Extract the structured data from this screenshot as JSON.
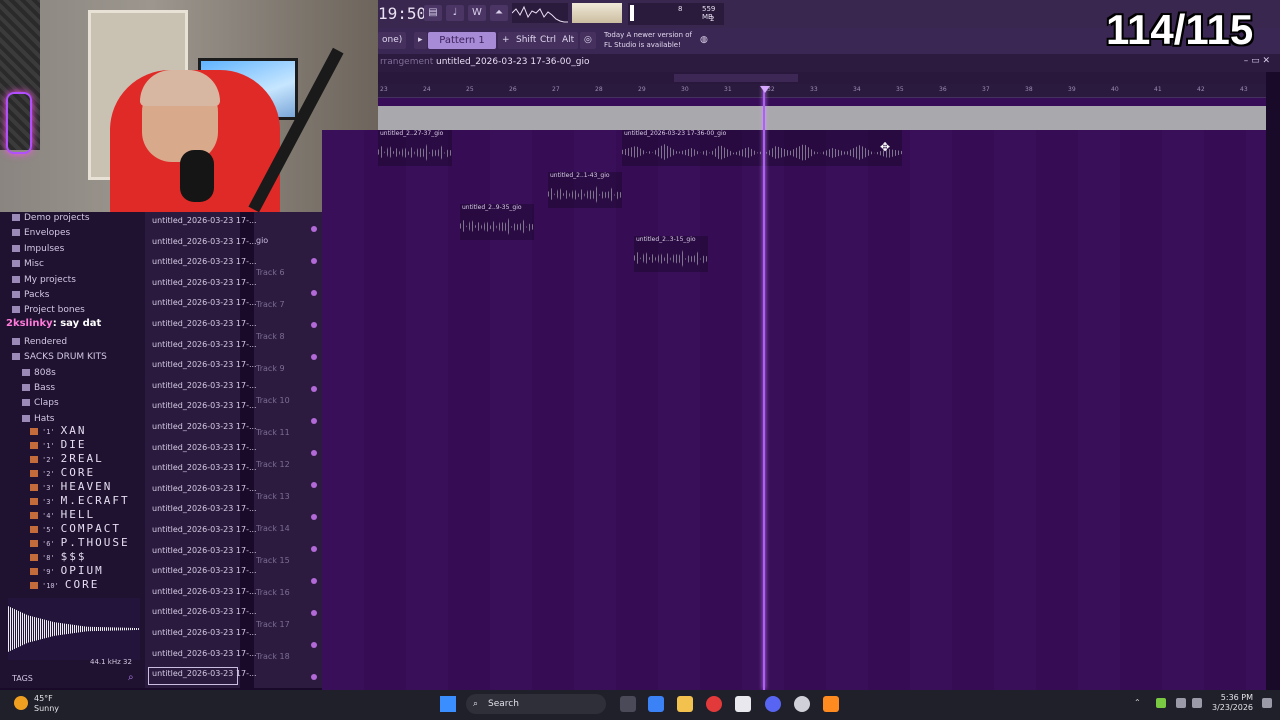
{
  "toolbar": {
    "clock": "19:50",
    "cpu_label": "559 MB",
    "cpu_num": "8",
    "cpu_num2": "2"
  },
  "toolbar2": {
    "snap": "one)",
    "pattern": "Pattern 1",
    "shift": "Shift",
    "ctrl": "Ctrl",
    "alt": "Alt",
    "news_line1": "Today  A newer version of",
    "news_line2": "FL Studio is available!"
  },
  "playlist": {
    "breadcrumb_left": "rrangement",
    "title": "untitled_2026-03-23 17-36-00_gio",
    "ruler": [
      "23",
      "24",
      "25",
      "26",
      "27",
      "28",
      "29",
      "30",
      "31",
      "32",
      "33",
      "34",
      "35",
      "36",
      "37",
      "38",
      "39",
      "40",
      "41",
      "42",
      "43"
    ],
    "clips": [
      {
        "name": "untitled_2..27-37_gio"
      },
      {
        "name": "untitled_2026-03-23 17-36-00_gio"
      },
      {
        "name": "untitled_2..1-43_gio"
      },
      {
        "name": "untitled_2..9-35_gio"
      },
      {
        "name": "untitled_2..3-15_gio"
      }
    ]
  },
  "browser": {
    "items": [
      "Demo projects",
      "Envelopes",
      "Impulses",
      "Misc",
      "My projects",
      "Packs",
      "Project bones",
      "Rendered",
      "SACKS DRUM KITS",
      "808s",
      "Bass",
      "Claps",
      "Hats"
    ],
    "kits": [
      {
        "num": "'1'",
        "name": "XAN"
      },
      {
        "num": "'1'",
        "name": "DIE"
      },
      {
        "num": "'2'",
        "name": "2REAL"
      },
      {
        "num": "'2'",
        "name": "CORE"
      },
      {
        "num": "'3'",
        "name": "HEAVEN"
      },
      {
        "num": "'3'",
        "name": "M.ECRAFT"
      },
      {
        "num": "'4'",
        "name": "HELL"
      },
      {
        "num": "'5'",
        "name": "COMPACT"
      },
      {
        "num": "'6'",
        "name": "P.THOUSE"
      },
      {
        "num": "'8'",
        "name": "$$$"
      },
      {
        "num": "'9'",
        "name": "OPIUM"
      },
      {
        "num": "'10'",
        "name": "CORE"
      }
    ],
    "chat_user": "2kslinky",
    "chat_msg": ": say dat",
    "sample_rate": "44.1 kHz 32",
    "tags": "TAGS"
  },
  "files": {
    "label": "untitled_2026-03-23 17-...",
    "count": 23
  },
  "tracks": {
    "first": "gio",
    "names": [
      "Track 6",
      "Track 7",
      "Track 8",
      "Track 9",
      "Track 10",
      "Track 11",
      "Track 12",
      "Track 13",
      "Track 14",
      "Track 15",
      "Track 16",
      "Track 17",
      "Track 18"
    ]
  },
  "overlay": {
    "counter": "114/115"
  },
  "taskbar": {
    "temp": "45°F",
    "weather": "Sunny",
    "search": "Search",
    "time": "5:36 PM",
    "date": "3/23/2026"
  }
}
